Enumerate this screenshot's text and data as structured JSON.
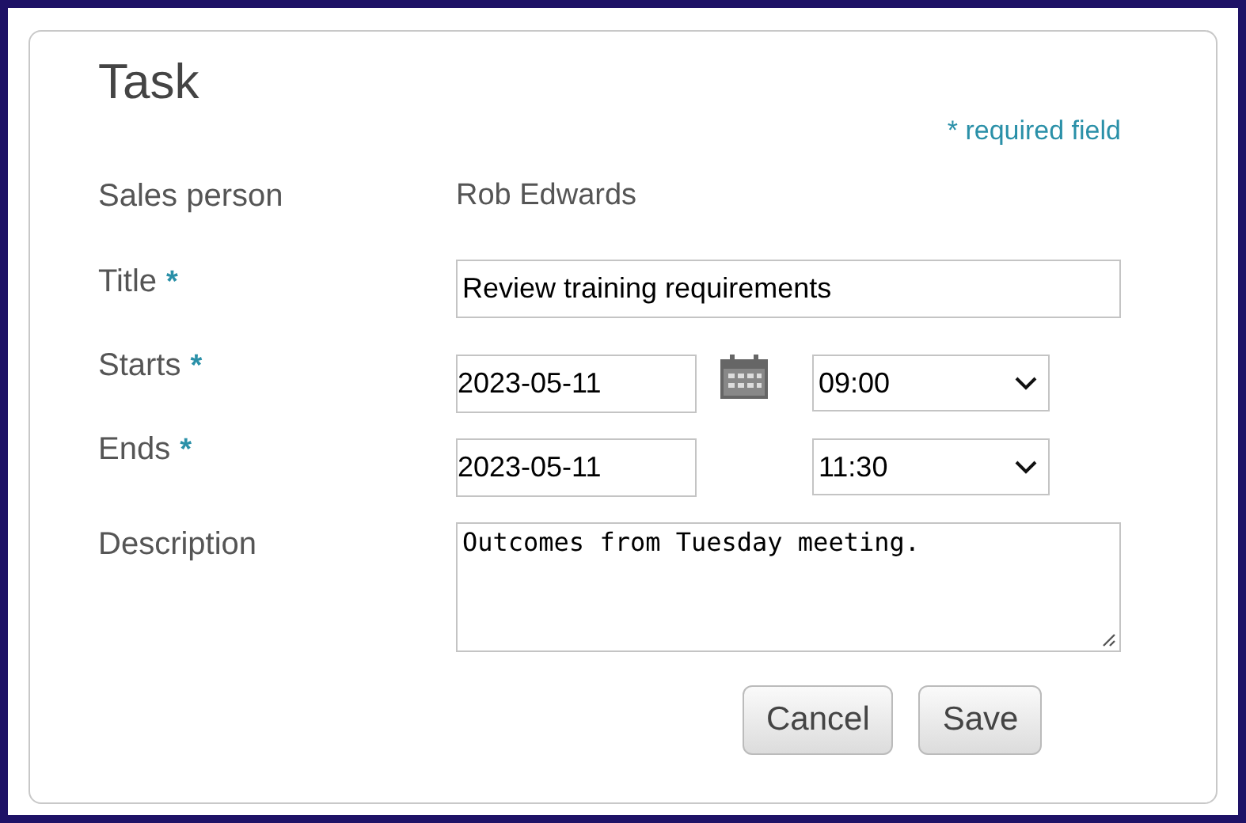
{
  "heading": "Task",
  "required_note": "* required field",
  "fields": [
    {
      "kind": "static",
      "label": "Sales person",
      "value": "Rob Edwards"
    },
    {
      "kind": "text",
      "label": "Title",
      "required_mark": "*",
      "value": "Review training requirements"
    },
    {
      "kind": "datetime",
      "label": "Starts",
      "required_mark": "*",
      "date": "2023-05-11",
      "time": "09:00",
      "calendar": true
    },
    {
      "kind": "datetime",
      "label": "Ends",
      "required_mark": "*",
      "date": "2023-05-11",
      "time": "11:30",
      "calendar": false
    },
    {
      "kind": "textarea",
      "label": "Description",
      "value": "Outcomes from Tuesday meeting."
    }
  ],
  "buttons": [
    "Cancel",
    "Save"
  ]
}
